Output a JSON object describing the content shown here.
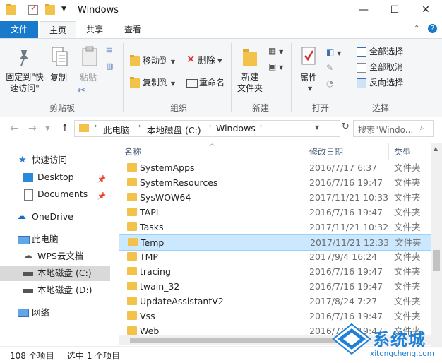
{
  "window": {
    "title": "Windows"
  },
  "titlebar": {
    "minimize": "—",
    "maximize": "☐",
    "close": "✕"
  },
  "ribbon_tabs": {
    "file": "文件",
    "home": "主页",
    "share": "共享",
    "view": "查看"
  },
  "ribbon": {
    "clipboard": {
      "pin": "固定到\"快\n速访问\"",
      "pin_l1": "固定到\"快",
      "pin_l2": "速访问\"",
      "copy": "复制",
      "paste": "粘贴",
      "label": "剪贴板"
    },
    "organize": {
      "move_to": "移动到",
      "copy_to": "复制到",
      "delete": "删除",
      "rename": "重命名",
      "label": "组织"
    },
    "new": {
      "new_folder_l1": "新建",
      "new_folder_l2": "文件夹",
      "label": "新建"
    },
    "open": {
      "properties": "属性",
      "label": "打开"
    },
    "select": {
      "select_all": "全部选择",
      "select_none": "全部取消",
      "invert": "反向选择",
      "label": "选择"
    }
  },
  "address": {
    "segments": [
      "此电脑",
      "本地磁盘 (C:)",
      "Windows"
    ],
    "search_placeholder": "搜索\"Windo..."
  },
  "navpane": {
    "quick_access": "快速访问",
    "desktop": "Desktop",
    "documents": "Documents",
    "onedrive": "OneDrive",
    "this_pc": "此电脑",
    "wps": "WPS云文档",
    "disk_c": "本地磁盘 (C:)",
    "disk_d": "本地磁盘 (D:)",
    "network": "网络"
  },
  "columns": {
    "name": "名称",
    "date": "修改日期",
    "type": "类型"
  },
  "files": [
    {
      "name": "SystemApps",
      "date": "2016/7/17 6:37",
      "type": "文件夹"
    },
    {
      "name": "SystemResources",
      "date": "2016/7/16 19:47",
      "type": "文件夹"
    },
    {
      "name": "SysWOW64",
      "date": "2017/11/21 10:33",
      "type": "文件夹"
    },
    {
      "name": "TAPI",
      "date": "2016/7/16 19:47",
      "type": "文件夹"
    },
    {
      "name": "Tasks",
      "date": "2017/11/21 10:32",
      "type": "文件夹"
    },
    {
      "name": "Temp",
      "date": "2017/11/21 12:33",
      "type": "文件夹"
    },
    {
      "name": "TMP",
      "date": "2017/9/4 16:24",
      "type": "文件夹"
    },
    {
      "name": "tracing",
      "date": "2016/7/16 19:47",
      "type": "文件夹"
    },
    {
      "name": "twain_32",
      "date": "2016/7/16 19:47",
      "type": "文件夹"
    },
    {
      "name": "UpdateAssistantV2",
      "date": "2017/8/24 7:27",
      "type": "文件夹"
    },
    {
      "name": "Vss",
      "date": "2016/7/16 19:47",
      "type": "文件夹"
    },
    {
      "name": "Web",
      "date": "2016/7/16 19:47",
      "type": "文件夹"
    }
  ],
  "selected_index": 5,
  "status": {
    "count": "108 个项目",
    "selected": "选中 1 个项目"
  },
  "watermark": {
    "text": "系统城",
    "url": "xitongcheng.com"
  },
  "colors": {
    "accent": "#1979ca",
    "selection": "#cce8ff",
    "folder": "#f3c24a"
  }
}
